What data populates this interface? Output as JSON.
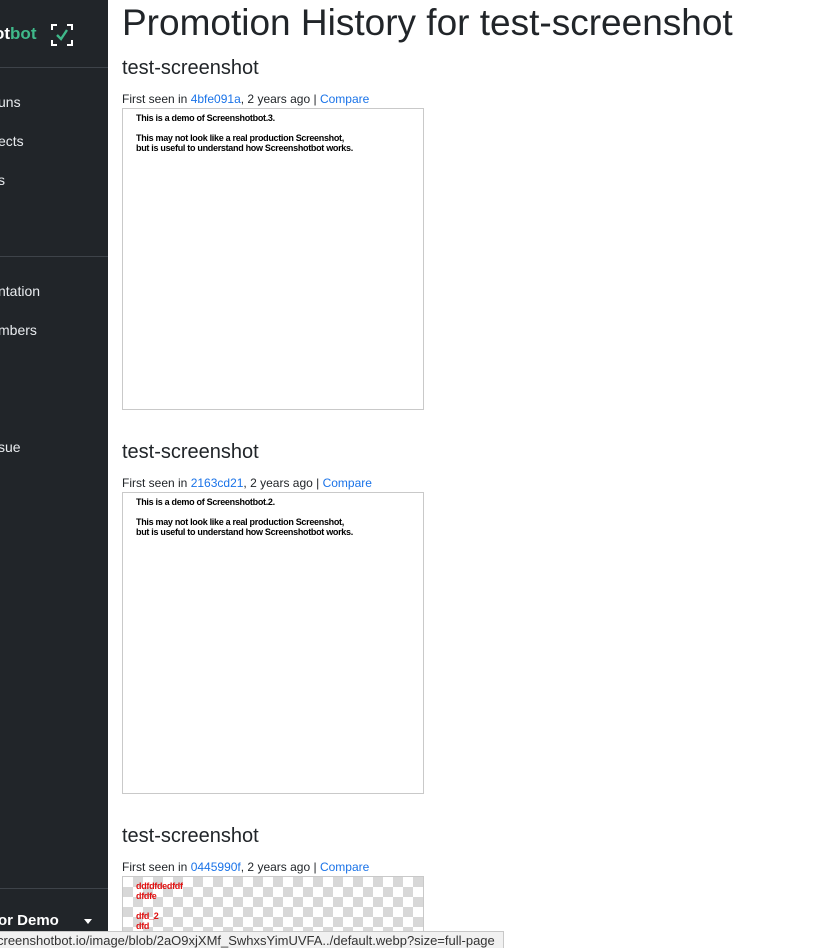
{
  "sidebar": {
    "brand_a": "ot",
    "brand_b": "bot",
    "nav": [
      {
        "label": "uns"
      },
      {
        "label": "ects"
      },
      {
        "label": "s"
      },
      {
        "label": "ntation"
      },
      {
        "label": "mbers"
      },
      {
        "label": "sue"
      }
    ],
    "org_label": "or Demo"
  },
  "page": {
    "title": "Promotion History for test-screenshot"
  },
  "entries": [
    {
      "title": "test-screenshot",
      "first_seen": "First seen in ",
      "commit": "4bfe091a",
      "ago": ", 2 years ago | ",
      "compare": "Compare",
      "thumb_lines": [
        "This is a demo of Screenshotbot.3.",
        "This may not look like a real production Screenshot,",
        "but is useful to understand how Screenshotbot works."
      ]
    },
    {
      "title": "test-screenshot",
      "first_seen": "First seen in ",
      "commit": "2163cd21",
      "ago": ", 2 years ago | ",
      "compare": "Compare",
      "thumb_lines": [
        "This is a demo of Screenshotbot.2.",
        "This may not look like a real production Screenshot,",
        "but is useful to understand how Screenshotbot works."
      ]
    },
    {
      "title": "test-screenshot",
      "first_seen": "First seen in ",
      "commit": "0445990f",
      "ago": ", 2 years ago | ",
      "compare": "Compare",
      "thumb_lines": [
        "ddfdfdedfdf",
        "dfdfe",
        "dfd_2",
        "dfd"
      ]
    }
  ],
  "statusbar": {
    "url": "creenshotbot.io/image/blob/2aO9xjXMf_SwhxsYimUVFA../default.webp?size=full-page"
  },
  "colors": {
    "sidebar_bg": "#212529",
    "brand_accent": "#3fb98a",
    "link": "#1a73e8"
  }
}
